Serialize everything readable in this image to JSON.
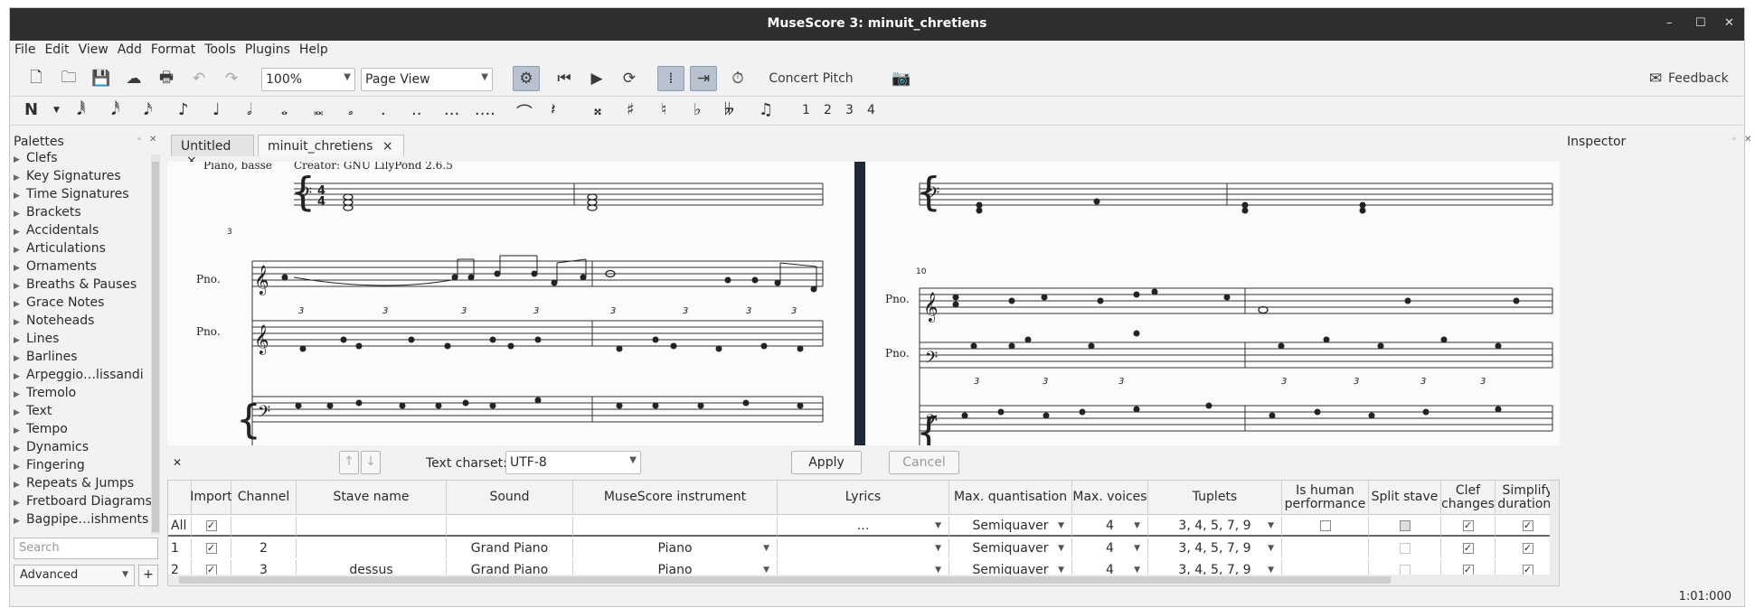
{
  "window": {
    "title": "MuseScore 3: minuit_chretiens",
    "minimize": "–",
    "maximize": "☐",
    "close": "✕"
  },
  "menu": [
    "File",
    "Edit",
    "View",
    "Add",
    "Format",
    "Tools",
    "Plugins",
    "Help"
  ],
  "toolbar": {
    "zoom_value": "100%",
    "view_mode": "Page View",
    "concert_pitch": "Concert Pitch",
    "feedback": "Feedback"
  },
  "note_toolbar": {
    "voices": [
      "1",
      "2",
      "3",
      "4"
    ]
  },
  "palettes": {
    "title": "Palettes",
    "items": [
      "Clefs",
      "Key Signatures",
      "Time Signatures",
      "Brackets",
      "Accidentals",
      "Articulations",
      "Ornaments",
      "Breaths & Pauses",
      "Grace Notes",
      "Noteheads",
      "Lines",
      "Barlines",
      "Arpeggio…lissandi",
      "Tremolo",
      "Text",
      "Tempo",
      "Dynamics",
      "Fingering",
      "Repeats & Jumps",
      "Fretboard Diagrams",
      "Bagpipe…ishments"
    ],
    "search_placeholder": "Search",
    "mode": "Advanced",
    "add": "+"
  },
  "tabs": [
    {
      "label": "Untitled",
      "close": "×"
    },
    {
      "label": "minuit_chretiens",
      "close": "×"
    }
  ],
  "score": {
    "left_page": {
      "header_instrument": "Piano, basse",
      "creator": "Creator: GNU LilyPond 2.6.5",
      "measure_number": "3",
      "staff_labels": [
        "Pno.",
        "Pno."
      ]
    },
    "right_page": {
      "measure_number": "10",
      "staff_labels": [
        "Pno.",
        "Pno."
      ]
    }
  },
  "import_panel": {
    "close": "✕",
    "up": "↑",
    "down": "↓",
    "charset_label": "Text charset:",
    "charset_value": "UTF-8",
    "apply": "Apply",
    "cancel": "Cancel",
    "columns": [
      "Import",
      "Channel",
      "Stave name",
      "Sound",
      "MuseScore instrument",
      "Lyrics",
      "Max. quantisation",
      "Max. voices",
      "Tuplets",
      "Is human performance",
      "Split stave",
      "Clef changes",
      "Simplify durations"
    ],
    "rows": [
      {
        "id": "All",
        "import": "✓",
        "channel": "",
        "stave": "",
        "sound": "",
        "instrument": "",
        "lyrics": "…",
        "quant": "Semiquaver",
        "voices": "4",
        "tuplets": "3, 4, 5, 7, 9",
        "human": "",
        "split": "",
        "clef": "✓",
        "simplify": "✓"
      },
      {
        "id": "1",
        "import": "✓",
        "channel": "2",
        "stave": "",
        "sound": "Grand Piano",
        "instrument": "Piano",
        "lyrics": "",
        "quant": "Semiquaver",
        "voices": "4",
        "tuplets": "3, 4, 5, 7, 9",
        "human": "",
        "split": "",
        "clef": "✓",
        "simplify": "✓"
      },
      {
        "id": "2",
        "import": "✓",
        "channel": "3",
        "stave": "dessus",
        "sound": "Grand Piano",
        "instrument": "Piano",
        "lyrics": "",
        "quant": "Semiquaver",
        "voices": "4",
        "tuplets": "3, 4, 5, 7, 9",
        "human": "",
        "split": "",
        "clef": "✓",
        "simplify": "✓"
      }
    ]
  },
  "inspector": {
    "title": "Inspector"
  },
  "status": {
    "time": "1:01:000"
  }
}
